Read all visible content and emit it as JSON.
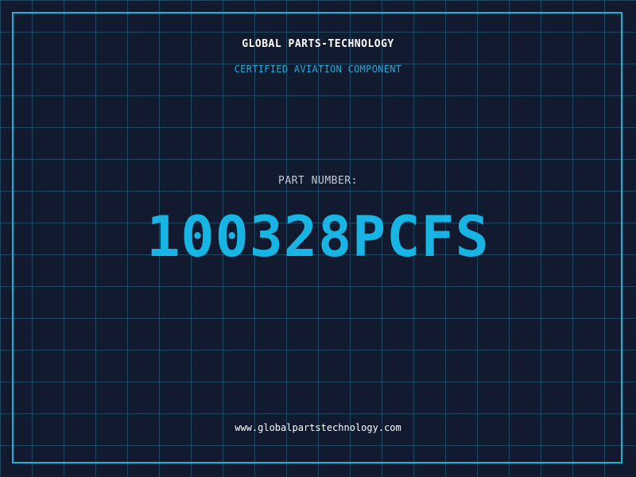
{
  "header": {
    "company": "GLOBAL PARTS-TECHNOLOGY",
    "subtitle": "CERTIFIED AVIATION COMPONENT"
  },
  "part": {
    "label": "PART NUMBER:",
    "number": "100328PCFS"
  },
  "footer": {
    "website": "www.globalpartstechnology.com"
  },
  "colors": {
    "background": "#111a2e",
    "grid": "#286e8c",
    "accent": "#18b4e3",
    "frame": "#1fb0d8"
  }
}
